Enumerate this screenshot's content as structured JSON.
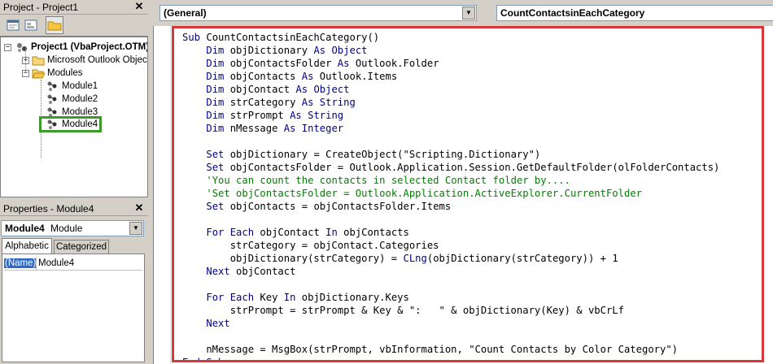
{
  "project_pane": {
    "title": "Project - Project1",
    "tree": {
      "root": "Project1 (VbaProject.OTM)",
      "folder1": "Microsoft Outlook Objects",
      "folder2": "Modules",
      "modules": [
        "Module1",
        "Module2",
        "Module3",
        "Module4"
      ]
    }
  },
  "properties_pane": {
    "title": "Properties - Module4",
    "object_name": "Module4",
    "object_type": "Module",
    "tabs": [
      "Alphabetic",
      "Categorized"
    ],
    "prop_name": "(Name)",
    "prop_value": "Module4"
  },
  "code_window": {
    "object_dropdown": "(General)",
    "procedure_dropdown": "CountContactsinEachCategory"
  },
  "code_lines": [
    [
      [
        "kw",
        "Sub "
      ],
      [
        "tx",
        "CountContactsinEachCategory()"
      ]
    ],
    [
      [
        "tx",
        "    "
      ],
      [
        "kw",
        "Dim "
      ],
      [
        "tx",
        "objDictionary "
      ],
      [
        "kw",
        "As Object"
      ]
    ],
    [
      [
        "tx",
        "    "
      ],
      [
        "kw",
        "Dim "
      ],
      [
        "tx",
        "objContactsFolder "
      ],
      [
        "kw",
        "As "
      ],
      [
        "tx",
        "Outlook.Folder"
      ]
    ],
    [
      [
        "tx",
        "    "
      ],
      [
        "kw",
        "Dim "
      ],
      [
        "tx",
        "objContacts "
      ],
      [
        "kw",
        "As "
      ],
      [
        "tx",
        "Outlook.Items"
      ]
    ],
    [
      [
        "tx",
        "    "
      ],
      [
        "kw",
        "Dim "
      ],
      [
        "tx",
        "objContact "
      ],
      [
        "kw",
        "As Object"
      ]
    ],
    [
      [
        "tx",
        "    "
      ],
      [
        "kw",
        "Dim "
      ],
      [
        "tx",
        "strCategory "
      ],
      [
        "kw",
        "As String"
      ]
    ],
    [
      [
        "tx",
        "    "
      ],
      [
        "kw",
        "Dim "
      ],
      [
        "tx",
        "strPrompt "
      ],
      [
        "kw",
        "As String"
      ]
    ],
    [
      [
        "tx",
        "    "
      ],
      [
        "kw",
        "Dim "
      ],
      [
        "tx",
        "nMessage "
      ],
      [
        "kw",
        "As Integer"
      ]
    ],
    [
      [
        "tx",
        ""
      ]
    ],
    [
      [
        "tx",
        "    "
      ],
      [
        "kw",
        "Set "
      ],
      [
        "tx",
        "objDictionary = CreateObject(\"Scripting.Dictionary\")"
      ]
    ],
    [
      [
        "tx",
        "    "
      ],
      [
        "kw",
        "Set "
      ],
      [
        "tx",
        "objContactsFolder = Outlook.Application.Session.GetDefaultFolder(olFolderContacts)"
      ]
    ],
    [
      [
        "tx",
        "    "
      ],
      [
        "cm",
        "'You can count the contacts in selected Contact folder by...."
      ]
    ],
    [
      [
        "tx",
        "    "
      ],
      [
        "cm",
        "'Set objContactsFolder = Outlook.Application.ActiveExplorer.CurrentFolder"
      ]
    ],
    [
      [
        "tx",
        "    "
      ],
      [
        "kw",
        "Set "
      ],
      [
        "tx",
        "objContacts = objContactsFolder.Items"
      ]
    ],
    [
      [
        "tx",
        ""
      ]
    ],
    [
      [
        "tx",
        "    "
      ],
      [
        "kw",
        "For Each "
      ],
      [
        "tx",
        "objContact "
      ],
      [
        "kw",
        "In "
      ],
      [
        "tx",
        "objContacts"
      ]
    ],
    [
      [
        "tx",
        "        strCategory = objContact.Categories"
      ]
    ],
    [
      [
        "tx",
        "        objDictionary(strCategory) = "
      ],
      [
        "kw",
        "CLng"
      ],
      [
        "tx",
        "(objDictionary(strCategory)) + 1"
      ]
    ],
    [
      [
        "tx",
        "    "
      ],
      [
        "kw",
        "Next "
      ],
      [
        "tx",
        "objContact"
      ]
    ],
    [
      [
        "tx",
        ""
      ]
    ],
    [
      [
        "tx",
        "    "
      ],
      [
        "kw",
        "For Each "
      ],
      [
        "tx",
        "Key "
      ],
      [
        "kw",
        "In "
      ],
      [
        "tx",
        "objDictionary.Keys"
      ]
    ],
    [
      [
        "tx",
        "        strPrompt = strPrompt & Key & \":   \" & objDictionary(Key) & vbCrLf"
      ]
    ],
    [
      [
        "tx",
        "    "
      ],
      [
        "kw",
        "Next"
      ]
    ],
    [
      [
        "tx",
        ""
      ]
    ],
    [
      [
        "tx",
        "    nMessage = MsgBox(strPrompt, vbInformation, \"Count Contacts by Color Category\")"
      ]
    ],
    [
      [
        "kw",
        "End Sub"
      ]
    ]
  ],
  "colors": {
    "keyword": "#00008b",
    "comment": "#008000",
    "highlight_red": "#d9383a",
    "highlight_green": "#3c9a2a"
  }
}
